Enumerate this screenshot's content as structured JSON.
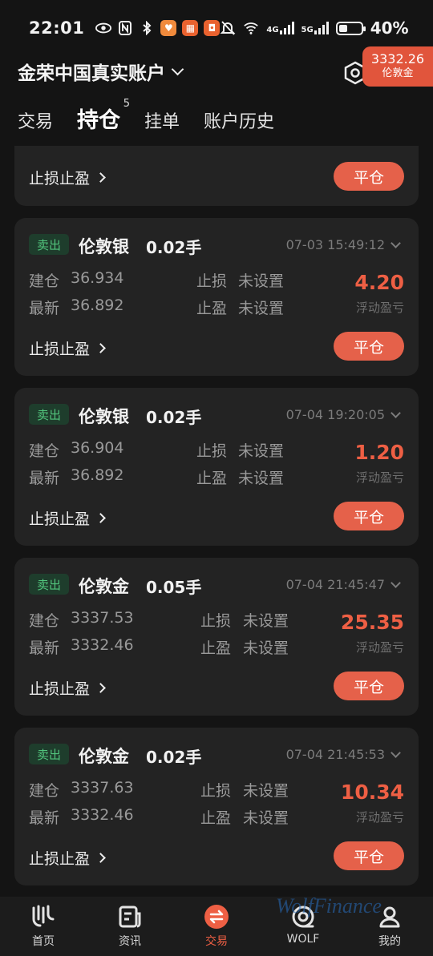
{
  "status_bar": {
    "time": "22:01",
    "left_icons": [
      "eye-icon",
      "nfc-icon",
      "bluetooth-icon",
      "app-icon-1",
      "app-icon-2",
      "app-icon-3"
    ],
    "right_icons": [
      "mute-icon",
      "wifi-icon",
      "signal-4g-icon",
      "signal-5g-icon",
      "battery-icon"
    ],
    "net1": "4G",
    "net2": "5G",
    "battery": "40%",
    "battery_level": 0.4
  },
  "header": {
    "account": "金荣中国真实账户",
    "badge_price": "3332.26",
    "badge_name": "伦敦金"
  },
  "tabs": [
    {
      "label": "交易"
    },
    {
      "label": "持仓",
      "count": "5"
    },
    {
      "label": "挂单"
    },
    {
      "label": "账户历史"
    }
  ],
  "labels": {
    "open": "建仓",
    "latest": "最新",
    "stop_loss": "止损",
    "take_profit": "止盈",
    "not_set": "未设置",
    "floating": "浮动盈亏",
    "sl_tp": "止损止盈",
    "close": "平仓"
  },
  "positions": [
    {
      "side": "卖出",
      "product": "伦敦银",
      "lots": "0.02手",
      "time": "07-03 15:49:12",
      "open": "36.934",
      "latest": "36.892",
      "pnl": "4.20"
    },
    {
      "side": "卖出",
      "product": "伦敦银",
      "lots": "0.02手",
      "time": "07-04 19:20:05",
      "open": "36.904",
      "latest": "36.892",
      "pnl": "1.20"
    },
    {
      "side": "卖出",
      "product": "伦敦金",
      "lots": "0.05手",
      "time": "07-04 21:45:47",
      "open": "3337.53",
      "latest": "3332.46",
      "pnl": "25.35"
    },
    {
      "side": "卖出",
      "product": "伦敦金",
      "lots": "0.02手",
      "time": "07-04 21:45:53",
      "open": "3337.63",
      "latest": "3332.46",
      "pnl": "10.34"
    }
  ],
  "bottom_nav": [
    {
      "label": "首页",
      "icon": "home-logo-icon"
    },
    {
      "label": "资讯",
      "icon": "news-icon"
    },
    {
      "label": "交易",
      "icon": "trade-icon",
      "active": true
    },
    {
      "label": "WOLF",
      "icon": "wolf-icon"
    },
    {
      "label": "我的",
      "icon": "profile-icon"
    }
  ],
  "watermark": "WolfFinance",
  "colors": {
    "background": "#141414",
    "card": "#232323",
    "accent": "#e5614a",
    "profit": "#ee5f44",
    "sell_tag_bg": "#1e3d2c",
    "sell_tag_text": "#52c57d"
  }
}
